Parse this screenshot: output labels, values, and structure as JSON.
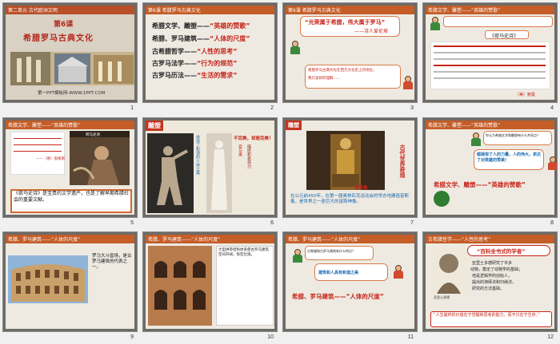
{
  "slides": [
    {
      "n": "1",
      "header": "第二单元 古代欧洲文明",
      "title_lesson": "第6课",
      "title_main": "希腊罗马古典文化",
      "footer": "第一PPT模板网-WWW.1PPT.COM"
    },
    {
      "n": "2",
      "header": "第6课 希腊罗马古典文化",
      "rows": [
        {
          "left": "希腊文学、雕塑——",
          "right": "“英雄的赞歌”"
        },
        {
          "left": "希腊、罗马建筑——",
          "right": "“人体的尺度”"
        },
        {
          "left": "古希腊哲学——",
          "right": "“人性的思考”"
        },
        {
          "left": "古罗马法学——",
          "right": "“行为的规范”"
        },
        {
          "left": "古罗马历法——",
          "right": "“生活的需求”"
        }
      ]
    },
    {
      "n": "3",
      "header": "第6课 希腊罗马古典文化",
      "quote": "“光荣属于希腊，伟大属于罗马”",
      "quote_author": "——诗人爱伦坡",
      "lines": [
        "希腊罗马古典文化在西方文化史上的地位，",
        "我们该如何理解……"
      ]
    },
    {
      "n": "4",
      "header": "希腊文学、雕塑——“英雄的赞歌”",
      "book": "《荷马史诗》",
      "caption": "（美）鲍曼"
    },
    {
      "n": "5",
      "header": "希腊文学、雕塑——“英雄的赞歌”",
      "pic_label": "荷马史诗",
      "note": "——（德）恩格斯",
      "body": "《荷马史诗》是宝贵的文学遗产，也是了解早期希腊社会的重要文献。"
    },
    {
      "n": "6",
      "header": "雕塑",
      "tag1": "不完美，却是完美！",
      "tag2": "描绘和表现力",
      "vlabel": "体现了和谐的人体之美",
      "vlabel2": "爱与美"
    },
    {
      "n": "7",
      "header": "雕塑",
      "label_right": "古代世界奇观",
      "caption": "宙斯像",
      "body": "在公元前450年，在第一届奥林匹克运动会的举办地建造宙斯像，是世界之一座巨大的宙斯神像。"
    },
    {
      "n": "8",
      "header": "希腊文学、雕塑——“英雄的赞歌”",
      "bubble1": "你认为希腊文学和雕塑有什么共同点？",
      "bubble2": "都展现了人的力量，人的伟大，表达了对英雄的赞美！",
      "title": "希腊文学、雕塑——“英雄的赞歌”"
    },
    {
      "n": "9",
      "header": "希腊、罗马建筑——“人体的尺度”",
      "body": "罗马大斗兽场，是古罗马建筑的代表之一。"
    },
    {
      "n": "10",
      "header": "希腊、罗马建筑——“人体的尺度”",
      "body": "大型拱券结构体系使古罗马建筑空间开阔，恢宏壮观。"
    },
    {
      "n": "11",
      "header": "希腊、罗马建筑——“人体的尺度”",
      "bubble1": "古希腊和古罗马建筑有什么特点？",
      "bubble2": "建筑和人具有和谐之美",
      "title": "希腊、罗马建筑——“人体的尺度”"
    },
    {
      "n": "12",
      "header": "古希腊哲学——“人性的思考”",
      "title": "“百科全书式的学者”",
      "lines": [
        "亚里士多德研究了许多",
        "动物，奠定了动物学的基础；",
        "他是逻辑学的创始人，",
        "提出的演绎法和归纳法，",
        "研究的方法基础。"
      ],
      "caption": "亚里士多德",
      "quote": "“人生最终的价值在于觉醒和思考的能力，而不只在于生存。”"
    }
  ]
}
